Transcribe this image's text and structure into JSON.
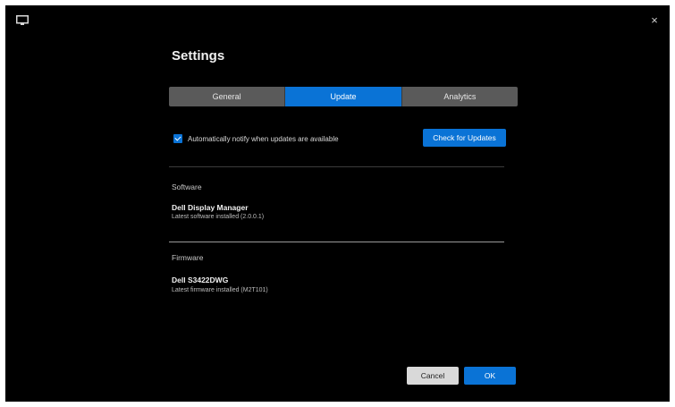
{
  "window": {
    "close_symbol": "×",
    "app_icon": "display-icon",
    "close_icon": "close-icon"
  },
  "settings": {
    "title": "Settings",
    "tabs": [
      {
        "label": "General",
        "active": false
      },
      {
        "label": "Update",
        "active": true
      },
      {
        "label": "Analytics",
        "active": false
      }
    ],
    "auto_update": {
      "checked": true,
      "label": "Automatically notify when updates are available"
    },
    "check_button_label": "Check for Updates",
    "software": {
      "heading": "Software",
      "name": "Dell Display Manager",
      "version_text": "Latest software installed (2.0.0.1)"
    },
    "firmware": {
      "heading": "Firmware",
      "name": "Dell S3422DWG",
      "version_text": "Latest firmware installed (M2T101)"
    },
    "buttons": {
      "cancel": "Cancel",
      "ok": "OK"
    },
    "colors": {
      "accent": "#0a73d6",
      "background": "#000000",
      "tab_inactive": "#5a5a5a"
    }
  }
}
